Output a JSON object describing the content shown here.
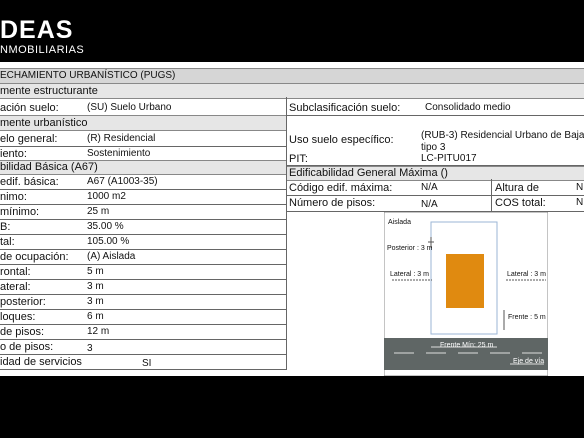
{
  "logo": {
    "line1": "DEAS",
    "line2": "NMOBILIARIAS"
  },
  "header": {
    "title": "ECHAMIENTO URBANÍSTICO (PUGS)"
  },
  "sections": {
    "estructurante": "mente  estructurante",
    "urbanistico": "mente  urbanístico",
    "edif_basica": "bilidad Básica (A67)",
    "edif_general": "Edificabilidad General Máxima ()"
  },
  "left_rows": [
    {
      "label": "ación suelo:",
      "value": "(SU) Suelo Urbano"
    },
    {
      "label": "elo general:",
      "value": "(R) Residencial"
    },
    {
      "label": "iento:",
      "value": "Sostenimiento"
    },
    {
      "label": "edif. básica:",
      "value": "A67 (A1003-35)"
    },
    {
      "label": "nimo:",
      "value": "1000 m2"
    },
    {
      "label": "mínimo:",
      "value": "25 m"
    },
    {
      "label": "B:",
      "value": "35.00 %"
    },
    {
      "label": "tal:",
      "value": "105.00 %"
    },
    {
      "label": "de ocupación:",
      "value": "(A) Aislada"
    },
    {
      "label": "rontal:",
      "value": "5 m"
    },
    {
      "label": "ateral:",
      "value": "3 m"
    },
    {
      "label": "posterior:",
      "value": "3 m"
    },
    {
      "label": "loques:",
      "value": "6 m"
    },
    {
      "label": "de pisos:",
      "value": "12 m"
    },
    {
      "label": "o de pisos:",
      "value": "3"
    },
    {
      "label": "idad de servicios",
      "value": "SI"
    }
  ],
  "right": {
    "subclas_label": "Subclasificación suelo:",
    "subclas_value": "Consolidado medio",
    "uso_label": "Uso suelo específico:",
    "uso_value_1": "(RUB-3) Residencial Urbano de Baja D",
    "uso_value_2": "tipo 3",
    "pit_label": "PIT:",
    "pit_value": "LC-PITU017",
    "cod_label": "Código edif. máxima:",
    "cod_value": "N/A",
    "altura_label": "Altura de",
    "altura_value": "N",
    "pisos_label": "Número de pisos:",
    "pisos_value": "N/A",
    "cos_label": "COS total:",
    "cos_value": "N"
  },
  "diagram": {
    "title": "Aislada",
    "posterior": "Posterior : 3 m",
    "lateral_left": "Lateral : 3 m",
    "lateral_right": "Lateral : 3 m",
    "frente": "Frente : 5 m",
    "frente_min": "Frente Mín: 25 m",
    "eje_via": "Eje de vía",
    "building_color": "#e08a10",
    "road_color": "#5f6665"
  }
}
